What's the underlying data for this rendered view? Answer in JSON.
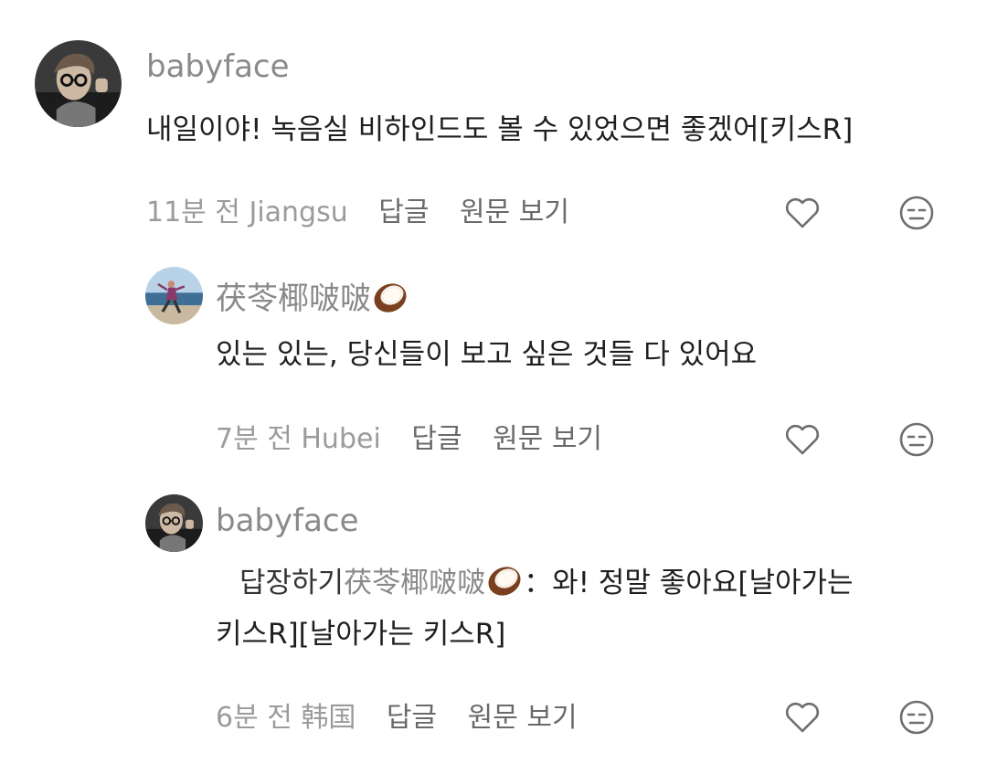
{
  "comments": [
    {
      "username": "babyface",
      "text": "내일이야! 녹음실 비하인드도 볼 수 있었으면 좋겠어[키스R]",
      "time": "11분 전",
      "location": "Jiangsu",
      "reply_label": "답글",
      "original_label": "원문 보기"
    },
    {
      "username": "茯苓椰啵啵",
      "username_emoji": "coconut-icon",
      "text": "있는 있는, 당신들이 보고 싶은 것들 다 있어요",
      "time": "7분 전",
      "location": "Hubei",
      "reply_label": "답글",
      "original_label": "원문 보기"
    },
    {
      "username": "babyface",
      "reply_prefix": "답장하기",
      "reply_to": "茯苓椰啵啵",
      "text_line1": "：와! 정말 좋아요[날아가는",
      "text_line2": "키스R][날아가는 키스R]",
      "time": "6분 전",
      "location": "韩国",
      "reply_label": "답글",
      "original_label": "원문 보기"
    }
  ],
  "colors": {
    "username": "#8a8a8a",
    "meta": "#9b9b9b",
    "action": "#6a6a6a",
    "icon": "#6e6e6e"
  }
}
